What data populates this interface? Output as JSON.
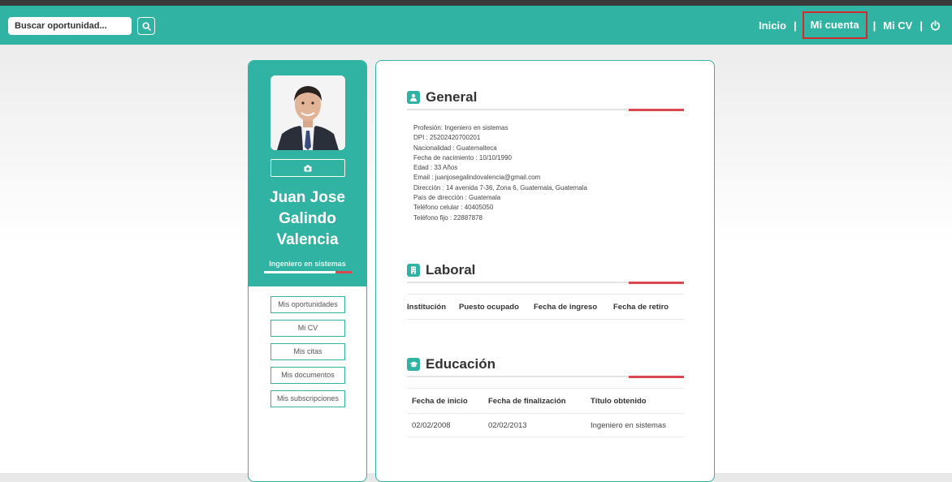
{
  "header": {
    "search_placeholder": "Buscar oportunidad...",
    "nav": {
      "inicio": "Inicio",
      "mi_cuenta": "Mi cuenta",
      "mi_cv": "Mi CV",
      "separator": "|"
    }
  },
  "profile": {
    "name_lines": [
      "Juan Jose",
      "Galindo",
      "Valencia"
    ],
    "profession": "Ingeniero en sistemas",
    "menu": [
      "Mis oportunidades",
      "Mi CV",
      "Mis citas",
      "Mis documentos",
      "Mis subscripciones"
    ]
  },
  "general": {
    "title": "General",
    "rows": [
      "Profesión: Ingeniero en sistemas",
      "DPI : 25202420700201",
      "Nacionalidad : Guatemalteca",
      "Fecha de nacimiento : 10/10/1990",
      "Edad : 33 Años",
      "Email : juanjosegalindovalencia@gmail.com",
      "Dirección : 14 avenida 7-36, Zona 6, Guatemala, Guatemala",
      "País de dirección : Guatemala",
      "Teléfono celular : 40405050",
      "Teléfono fijo : 22887878"
    ]
  },
  "laboral": {
    "title": "Laboral",
    "columns": [
      "Institución",
      "Puesto ocupado",
      "Fecha de ingreso",
      "Fecha de retiro"
    ]
  },
  "educacion": {
    "title": "Educación",
    "columns": [
      "Fecha de inicio",
      "Fecha de finalización",
      "Título obtenido"
    ],
    "rows": [
      [
        "02/02/2008",
        "02/02/2013",
        "Ingeniero en sistemas"
      ]
    ]
  },
  "colors": {
    "primary": "#30b3a2",
    "accent_red": "#d9484f",
    "highlight_box": "#d32b2b"
  }
}
